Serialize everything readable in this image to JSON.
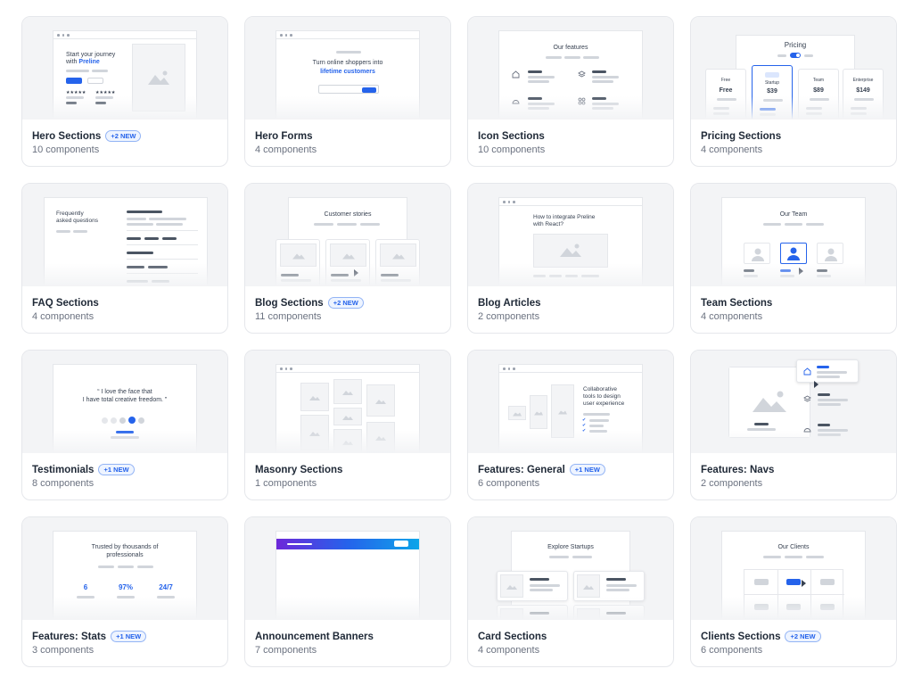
{
  "cards": [
    {
      "title": "Hero Sections",
      "badge": "+2 NEW",
      "count": "10 components",
      "preview": {
        "line1": "Start your journey",
        "line2_plain": "with ",
        "line2_blue": "Preline",
        "stars": "★★★★★"
      }
    },
    {
      "title": "Hero Forms",
      "badge": "",
      "count": "4 components",
      "preview": {
        "line1": "Turn online shoppers into",
        "line2_blue": "lifetime customers"
      }
    },
    {
      "title": "Icon Sections",
      "badge": "",
      "count": "10 components",
      "preview": {
        "heading": "Our features"
      }
    },
    {
      "title": "Pricing Sections",
      "badge": "",
      "count": "4 components",
      "preview": {
        "heading": "Pricing",
        "plans": [
          "Free",
          "Startup",
          "Team",
          "Enterprise"
        ],
        "prices": [
          "Free",
          "$39",
          "$89",
          "$149"
        ]
      }
    },
    {
      "title": "FAQ Sections",
      "badge": "",
      "count": "4 components",
      "preview": {
        "line1": "Frequently",
        "line2": "asked questions"
      }
    },
    {
      "title": "Blog Sections",
      "badge": "+2 NEW",
      "count": "11 components",
      "preview": {
        "heading": "Customer stories"
      }
    },
    {
      "title": "Blog Articles",
      "badge": "",
      "count": "2 components",
      "preview": {
        "line1": "How to integrate Preline",
        "line2": "with React?"
      }
    },
    {
      "title": "Team Sections",
      "badge": "",
      "count": "4 components",
      "preview": {
        "heading": "Our Team"
      }
    },
    {
      "title": "Testimonials",
      "badge": "+1 NEW",
      "count": "8 components",
      "preview": {
        "line1": "“ I love the face that",
        "line2": "I have total creative freedom. ”"
      }
    },
    {
      "title": "Masonry Sections",
      "badge": "",
      "count": "1 components",
      "preview": {}
    },
    {
      "title": "Features: General",
      "badge": "+1 NEW",
      "count": "6 components",
      "preview": {
        "line1": "Collaborative",
        "line2": "tools to design",
        "line3": "user experience"
      }
    },
    {
      "title": "Features: Navs",
      "badge": "",
      "count": "2 components",
      "preview": {}
    },
    {
      "title": "Features: Stats",
      "badge": "+1 NEW",
      "count": "3 components",
      "preview": {
        "line1": "Trusted by thousands of",
        "line2": "professionals",
        "stats": [
          "6",
          "97%",
          "24/7"
        ]
      }
    },
    {
      "title": "Announcement Banners",
      "badge": "",
      "count": "7 components",
      "preview": {}
    },
    {
      "title": "Card Sections",
      "badge": "",
      "count": "4 components",
      "preview": {
        "heading": "Explore Startups"
      }
    },
    {
      "title": "Clients Sections",
      "badge": "+2 NEW",
      "count": "6 components",
      "preview": {
        "heading": "Our Clients"
      }
    }
  ],
  "icons": {
    "image_placeholder": "image-placeholder-icon",
    "cursor": "cursor-icon",
    "avatar": "avatar-icon"
  },
  "colors": {
    "accent": "#2563eb",
    "badge_bg": "#eef4ff",
    "card_border": "#e5e7eb",
    "preview_bg": "#f3f4f6"
  }
}
